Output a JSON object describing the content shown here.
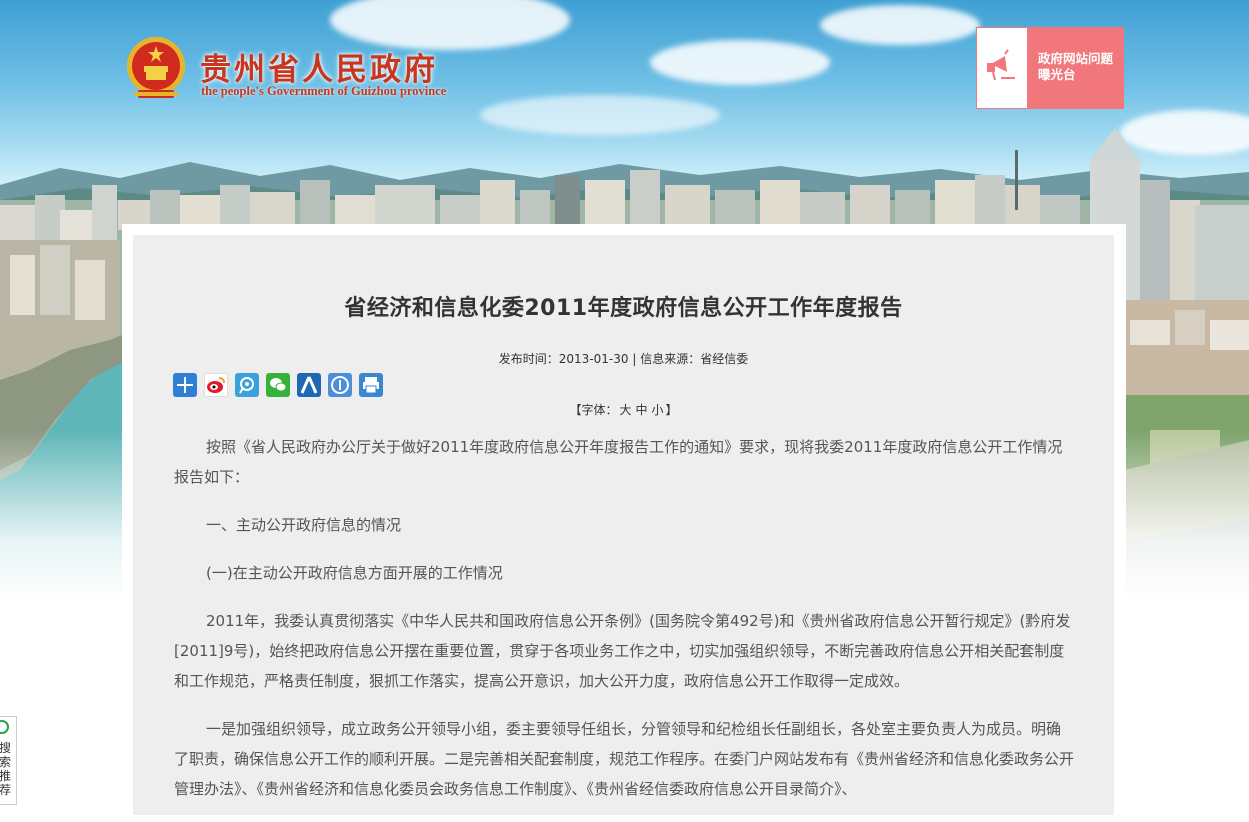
{
  "header": {
    "site_title": "贵州省人民政府",
    "site_subtitle": "the people's Government of Guizhou province",
    "expose_button": "政府网站问题曝光台"
  },
  "article": {
    "title": "省经济和信息化委2011年度政府信息公开工作年度报告",
    "meta": "发布时间：2013-01-30 | 信息来源：省经信委",
    "share_icons": [
      "plus-icon",
      "weibo-icon",
      "tencent-weibo-icon",
      "wechat-icon",
      "renren-icon",
      "qzone-icon",
      "print-icon"
    ],
    "font_size": {
      "label_open": "【字体：",
      "large": "大",
      "medium": "中",
      "small": "小",
      "label_close": "】"
    },
    "paragraphs": [
      "按照《省人民政府办公厅关于做好2011年度政府信息公开年度报告工作的通知》要求，现将我委2011年度政府信息公开工作情况报告如下：",
      "一、主动公开政府信息的情况",
      "(一)在主动公开政府信息方面开展的工作情况",
      "2011年，我委认真贯彻落实《中华人民共和国政府信息公开条例》(国务院令第492号)和《贵州省政府信息公开暂行规定》(黔府发[2011]9号)，始终把政府信息公开摆在重要位置，贯穿于各项业务工作之中，切实加强组织领导，不断完善政府信息公开相关配套制度和工作规范，严格责任制度，狠抓工作落实，提高公开意识，加大公开力度，政府信息公开工作取得一定成效。",
      "一是加强组织领导，成立政务公开领导小组，委主要领导任组长，分管领导和纪检组长任副组长，各处室主要负责人为成员。明确了职责，确保信息公开工作的顺利开展。二是完善相关配套制度，规范工作程序。在委门户网站发布有《贵州省经济和信息化委政务公开管理办法》、《贵州省经济和信息化委员会政务信息工作制度》、《贵州省经信委政府信息公开目录简介》、"
    ]
  },
  "side_widget": {
    "text": "搜索推荐"
  },
  "colors": {
    "title_red": "#c8361f",
    "expose_pink": "#f2777c",
    "content_bg": "#eeeeee"
  }
}
